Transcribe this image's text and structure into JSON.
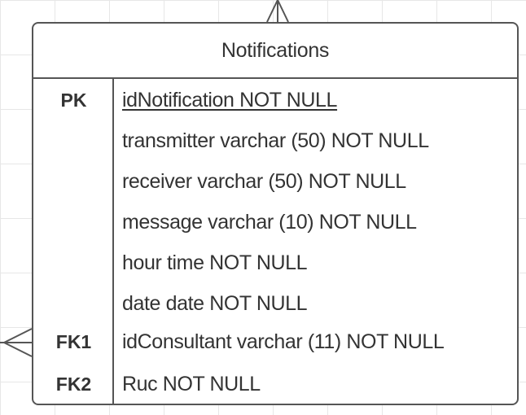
{
  "entity": {
    "title": "Notifications",
    "rows": [
      {
        "key": "PK",
        "attribute": "idNotification NOT NULL",
        "underline": true
      },
      {
        "key": "",
        "attribute": "transmitter varchar (50) NOT NULL"
      },
      {
        "key": "",
        "attribute": "receiver varchar (50) NOT NULL"
      },
      {
        "key": "",
        "attribute": "message varchar (10) NOT NULL"
      },
      {
        "key": "",
        "attribute": "hour time NOT NULL"
      },
      {
        "key": "",
        "attribute": "date date NOT NULL"
      },
      {
        "key": "FK1",
        "attribute": "idConsultant varchar (11) NOT NULL"
      },
      {
        "key": "FK2",
        "attribute": "Ruc NOT NULL"
      }
    ]
  },
  "relationships": [
    {
      "end": "top",
      "notation": "crow-foot"
    },
    {
      "end": "left",
      "notation": "crow-foot"
    }
  ],
  "colors": {
    "border": "#555555",
    "text": "#333333",
    "grid": "#e7e7e7",
    "background": "#ffffff"
  }
}
